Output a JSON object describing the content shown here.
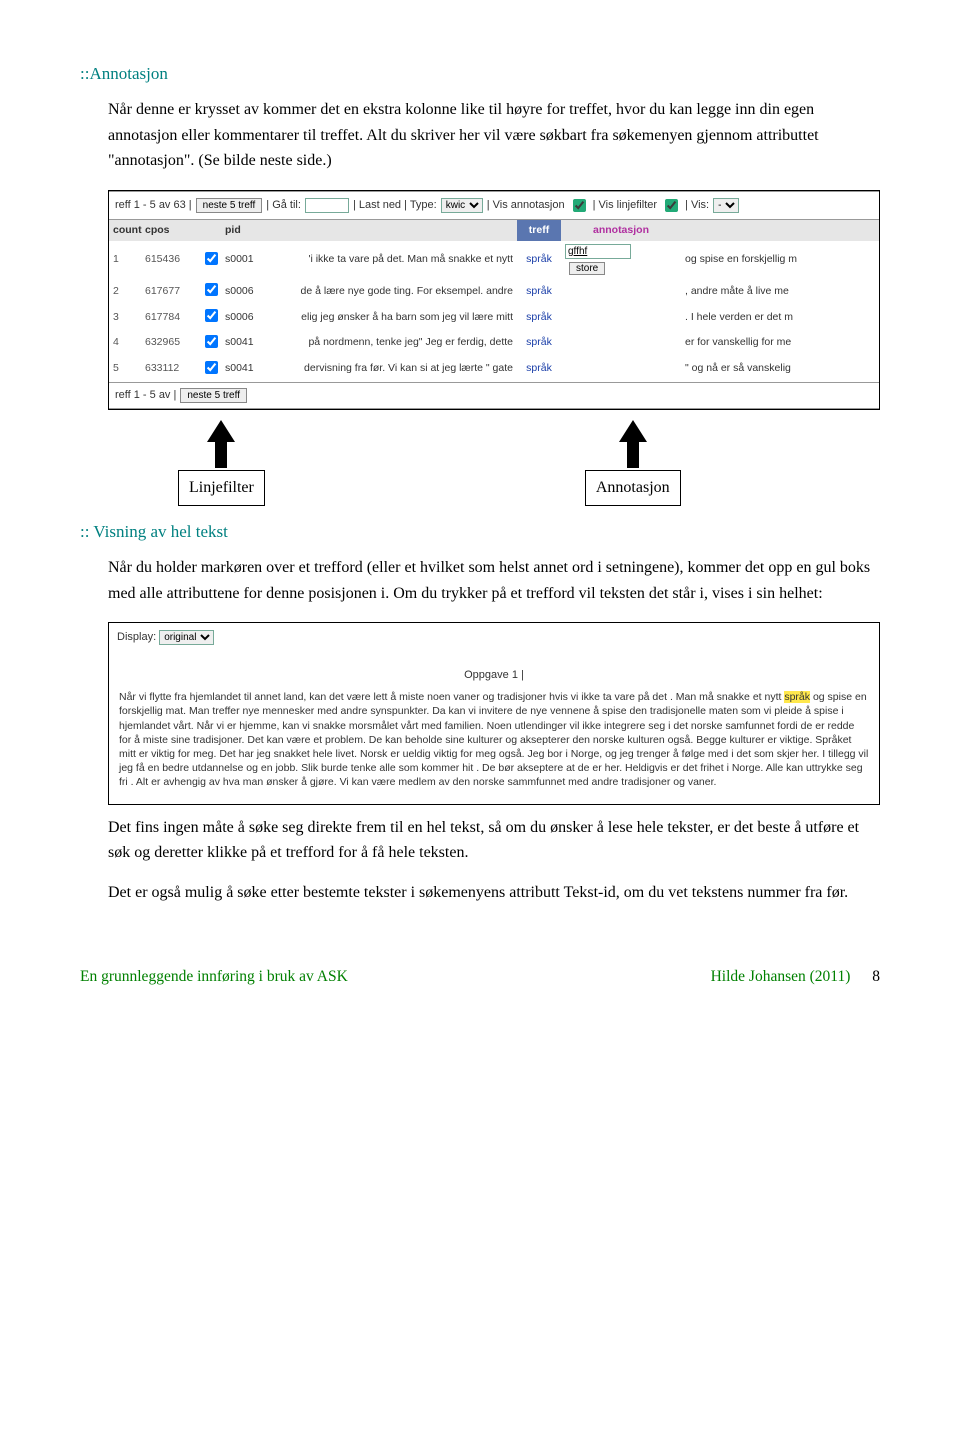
{
  "sec1": {
    "title": "::Annotasjon",
    "p1": "Når denne er krysset av kommer det en ekstra kolonne like til høyre for treffet, hvor du kan legge inn din egen annotasjon eller kommentarer til treffet. Alt du skriver her vil være søkbart fra søkemenyen gjennom attributtet \"annotasjon\". (Se bilde neste side.)"
  },
  "kwic": {
    "bar1_left": "reff 1 - 5 av 63  |",
    "neste": "neste 5 treff",
    "ga_til": "|  Gå til:",
    "last_ned": "|  Last ned  |  Type:",
    "type_val": "kwic",
    "vis_annot_label": "|  Vis annotasjon",
    "vis_linje_label": "|  Vis linjefilter",
    "vis3": "|  Vis:",
    "vis3_val": "-",
    "headers": {
      "count": "count",
      "cpos": "cpos",
      "pid": "pid",
      "treff": "treff",
      "annot": "annotasjon"
    },
    "rows": [
      {
        "n": "1",
        "cpos": "615436",
        "pid": "s0001",
        "left": "'i ikke ta vare på det. Man må snakke et nytt",
        "match": "språk",
        "annot": "gffhf",
        "right": "og spise en forskjellig m"
      },
      {
        "n": "2",
        "cpos": "617677",
        "pid": "s0006",
        "left": "de å lære nye gode ting. For eksempel. andre",
        "match": "språk",
        "annot": "",
        "right": ", andre måte å live me"
      },
      {
        "n": "3",
        "cpos": "617784",
        "pid": "s0006",
        "left": "elig jeg ønsker å ha barn som jeg vil lære mitt",
        "match": "språk",
        "annot": "",
        "right": ". I hele verden er det m"
      },
      {
        "n": "4",
        "cpos": "632965",
        "pid": "s0041",
        "left": "på nordmenn, tenke jeg\" Jeg er ferdig, dette",
        "match": "språk",
        "annot": "",
        "right": "er for vanskellig for me"
      },
      {
        "n": "5",
        "cpos": "633112",
        "pid": "s0041",
        "left": "dervisning fra før. Vi kan si at jeg lærte \" gate",
        "match": "språk",
        "annot": "",
        "right": "\" og nå er så vanskelig"
      }
    ],
    "store": "store",
    "bar2_left": "reff 1 - 5 av      |"
  },
  "callouts": {
    "annot": "Annotasjon",
    "linje": "Linjefilter"
  },
  "sec2": {
    "title": ":: Visning av hel tekst",
    "p1": "Når du holder markøren over et trefford (eller et hvilket som helst annet ord i setningene), kommer det opp en gul boks med alle attributtene for denne posisjonen i. Om du trykker på et trefford vil teksten det står i, vises i sin helhet:"
  },
  "full": {
    "display_label": "Display:",
    "display_val": "original",
    "oppgave": "Oppgave 1 |",
    "text_before": "Når vi flytte fra hjemlandet til annet land, kan det være lett å miste noen vaner og tradisjoner hvis vi ikke ta vare på det . Man må snakke et nytt ",
    "hl": "språk",
    "text_after": " og spise en forskjellig mat. Man treffer nye mennesker med andre synspunkter. Da kan vi invitere de nye vennene å spise den tradisjonelle maten som vi pleide å spise i hjemlandet vårt. Når vi er hjemme, kan vi snakke morsmålet vårt med familien. Noen utlendinger vil ikke integrere seg i det norske samfunnet fordi de er redde for å miste sine tradisjoner. Det kan være et problem. De kan beholde sine kulturer og aksepterer den norske kulturen også. Begge kulturer er viktige. Språket mitt er viktig for meg. Det har jeg snakket hele livet. Norsk er ueldig viktig for meg også. Jeg bor i Norge, og jeg trenger å følge med i det som skjer her. I tillegg vil jeg få en bedre utdannelse og en jobb. Slik burde tenke alle som kommer hit . De bør akseptere at de er her. Heldigvis er det frihet i Norge. Alle kan uttrykke seg fri . Alt er avhengig av hva man ønsker å gjøre. Vi kan være medlem av den norske sammfunnet med andre tradisjoner og vaner."
  },
  "sec3": {
    "p1": "Det fins ingen måte å søke seg direkte frem til en hel tekst, så om du ønsker å lese hele tekster, er det beste å utføre et søk og deretter klikke på et trefford for å få hele teksten.",
    "p2": "Det er også mulig å søke etter bestemte tekster i søkemenyens attributt Tekst-id, om du vet tekstens nummer fra før."
  },
  "footer": {
    "left": "En grunnleggende innføring i bruk av ASK",
    "right": "Hilde Johansen (2011)",
    "page": "8"
  }
}
